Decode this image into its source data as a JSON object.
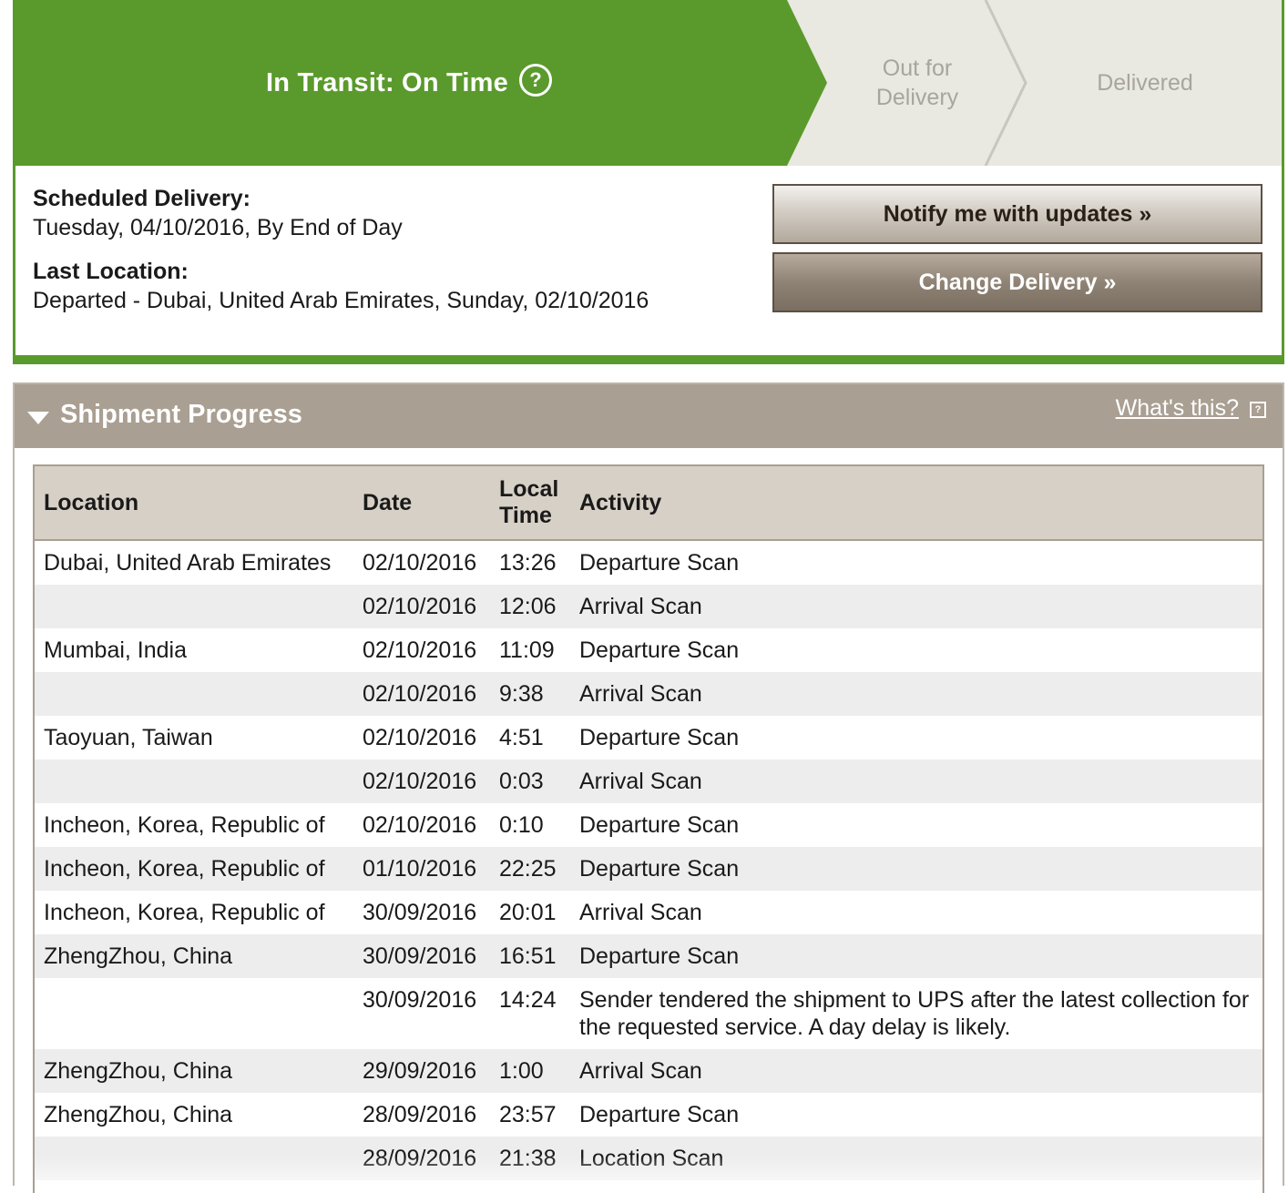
{
  "tracker": {
    "current_status": "In Transit: On Time",
    "help_glyph": "?",
    "next_steps": [
      "Out for Delivery",
      "Delivered"
    ],
    "colors": {
      "active": "#5a9a2c",
      "inactive": "#e9e8e1"
    }
  },
  "delivery": {
    "scheduled_label": "Scheduled Delivery:",
    "scheduled_value": "Tuesday, 04/10/2016, By End of Day",
    "last_location_label": "Last Location:",
    "last_location_value": "Departed - Dubai, United Arab Emirates, Sunday, 02/10/2016"
  },
  "actions": {
    "notify_label": "Notify me with updates »",
    "change_label": "Change Delivery »"
  },
  "progress": {
    "title": "Shipment Progress",
    "whats_this": "What's this?",
    "columns": [
      "Location",
      "Date",
      "Local Time",
      "Activity"
    ],
    "rows": [
      {
        "location": "Dubai, United Arab Emirates",
        "date": "02/10/2016",
        "time": "13:26",
        "activity": "Departure Scan"
      },
      {
        "location": "",
        "date": "02/10/2016",
        "time": "12:06",
        "activity": "Arrival Scan"
      },
      {
        "location": "Mumbai, India",
        "date": "02/10/2016",
        "time": "11:09",
        "activity": "Departure Scan"
      },
      {
        "location": "",
        "date": "02/10/2016",
        "time": "9:38",
        "activity": "Arrival Scan"
      },
      {
        "location": "Taoyuan, Taiwan",
        "date": "02/10/2016",
        "time": "4:51",
        "activity": "Departure Scan"
      },
      {
        "location": "",
        "date": "02/10/2016",
        "time": "0:03",
        "activity": "Arrival Scan"
      },
      {
        "location": "Incheon, Korea, Republic of",
        "date": "02/10/2016",
        "time": "0:10",
        "activity": "Departure Scan"
      },
      {
        "location": "Incheon, Korea, Republic of",
        "date": "01/10/2016",
        "time": "22:25",
        "activity": "Departure Scan"
      },
      {
        "location": "Incheon, Korea, Republic of",
        "date": "30/09/2016",
        "time": "20:01",
        "activity": "Arrival Scan"
      },
      {
        "location": "ZhengZhou, China",
        "date": "30/09/2016",
        "time": "16:51",
        "activity": "Departure Scan"
      },
      {
        "location": "",
        "date": "30/09/2016",
        "time": "14:24",
        "activity": "Sender tendered the shipment to UPS after the latest collection for the requested service. A day delay is likely."
      },
      {
        "location": "ZhengZhou, China",
        "date": "29/09/2016",
        "time": "1:00",
        "activity": "Arrival Scan"
      },
      {
        "location": "ZhengZhou, China",
        "date": "28/09/2016",
        "time": "23:57",
        "activity": "Departure Scan"
      },
      {
        "location": "",
        "date": "28/09/2016",
        "time": "21:38",
        "activity": "Location Scan"
      }
    ]
  }
}
